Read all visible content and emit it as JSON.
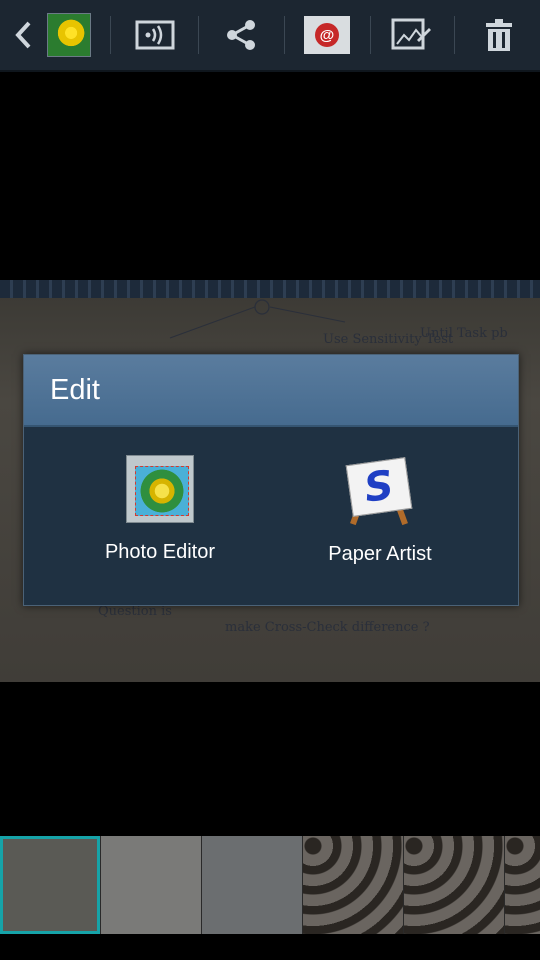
{
  "toolbar": {
    "items": [
      {
        "name": "back",
        "icon": "chevron-left-icon"
      },
      {
        "name": "app-thumbnail",
        "icon": "flower-thumbnail-icon"
      },
      {
        "name": "screen-mirroring",
        "icon": "screen-mirroring-icon"
      },
      {
        "name": "share",
        "icon": "share-icon"
      },
      {
        "name": "email",
        "icon": "email-icon"
      },
      {
        "name": "edit",
        "icon": "edit-icon"
      },
      {
        "name": "delete",
        "icon": "trash-icon"
      }
    ],
    "background": "#1c2631"
  },
  "dialog": {
    "title": "Edit",
    "options": [
      {
        "label": "Photo Editor",
        "icon": "photo-editor-icon"
      },
      {
        "label": "Paper Artist",
        "icon": "paper-artist-icon",
        "icon_letter": "S"
      }
    ],
    "title_bg": "#4d7398",
    "body_bg": "#1f3142"
  },
  "photo": {
    "handwriting": [
      "Use Sensitivity Test",
      "Until Task pb",
      "Question is",
      "make Cross-Check difference ?"
    ]
  },
  "filmstrip": {
    "thumbnails": [
      "sketch-note",
      "business-card",
      "map-photo",
      "dot-sheet-1",
      "dot-sheet-2",
      "dot-sheet-3"
    ],
    "selected_index": 0,
    "selected_color": "#16a3a8"
  }
}
